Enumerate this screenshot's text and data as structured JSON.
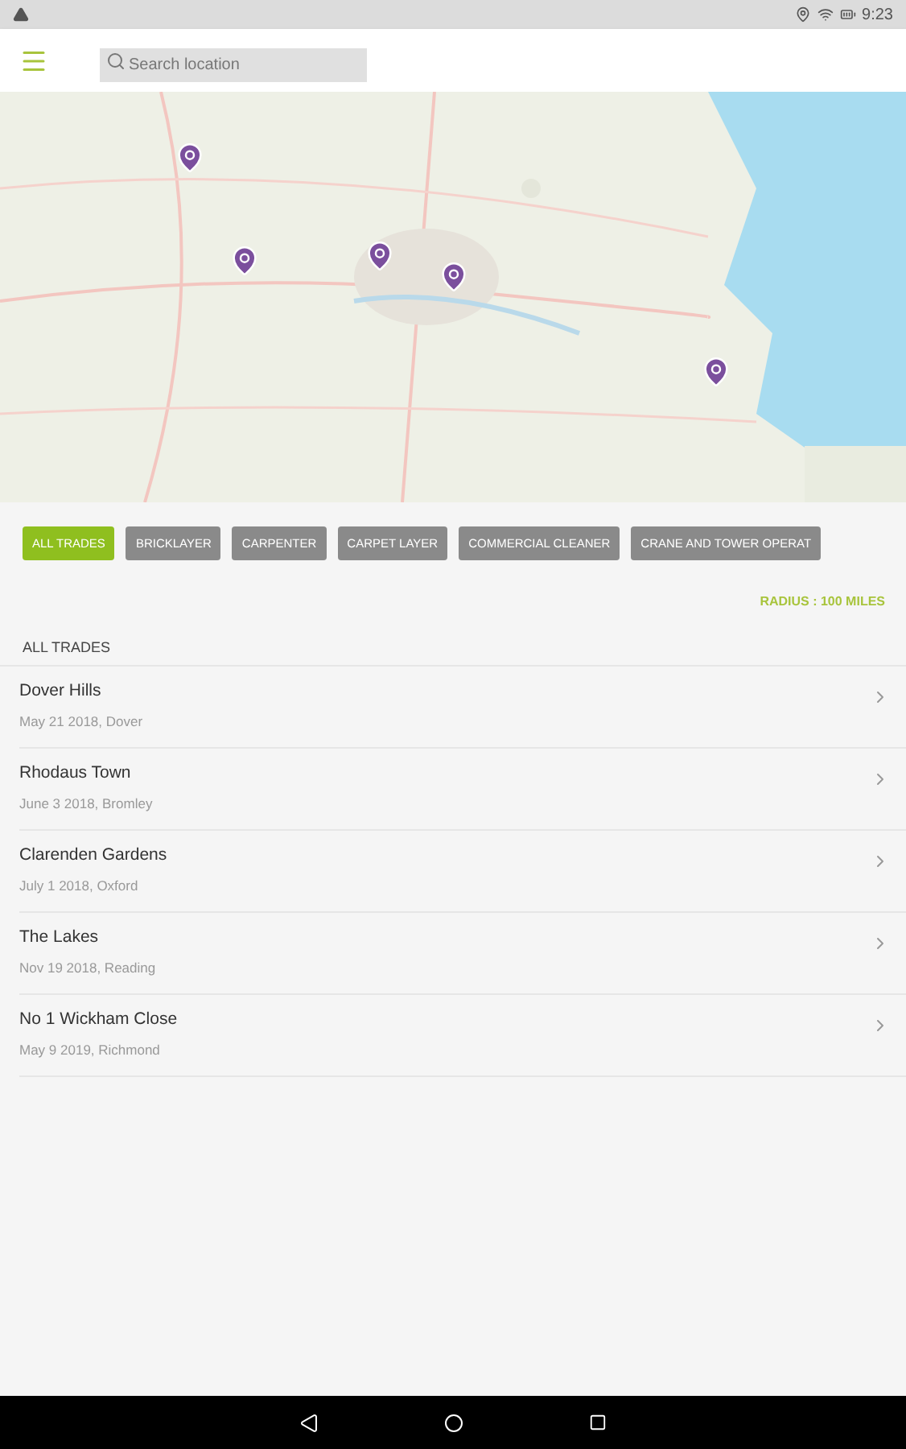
{
  "status_bar": {
    "time": "9:23"
  },
  "search": {
    "placeholder": "Search location"
  },
  "filters": [
    {
      "label": "ALL TRADES",
      "selected": true
    },
    {
      "label": "BRICKLAYER",
      "selected": false
    },
    {
      "label": "CARPENTER",
      "selected": false
    },
    {
      "label": "CARPET LAYER",
      "selected": false
    },
    {
      "label": "COMMERCIAL CLEANER",
      "selected": false
    },
    {
      "label": "CRANE AND TOWER OPERAT",
      "selected": false
    }
  ],
  "radius": "RADIUS : 100 MILES",
  "list_heading": "ALL TRADES",
  "items": [
    {
      "title": "Dover Hills",
      "subtitle": "May 21 2018, Dover"
    },
    {
      "title": "Rhodaus Town",
      "subtitle": "June 3 2018, Bromley"
    },
    {
      "title": "Clarenden Gardens",
      "subtitle": "July 1 2018, Oxford"
    },
    {
      "title": "The Lakes",
      "subtitle": "Nov 19 2018, Reading"
    },
    {
      "title": "No 1 Wickham Close",
      "subtitle": "May 9 2019, Richmond"
    }
  ]
}
